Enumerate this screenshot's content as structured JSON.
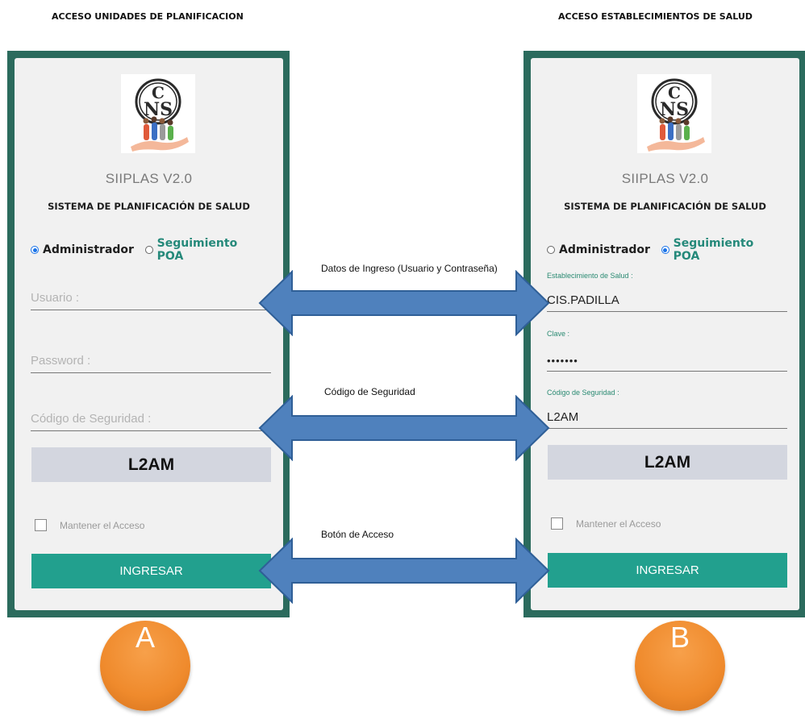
{
  "headings": {
    "left": "ACCESO UNIDADES DE PLANIFICACION",
    "right": "ACCESO ESTABLECIMIENTOS DE SALUD"
  },
  "logo": {
    "letters_top": "C",
    "letters_bottom": "NS"
  },
  "panel_a": {
    "app_title": "SIIPLAS V2.0",
    "app_subtitle": "SISTEMA DE PLANIFICACIÓN DE SALUD",
    "radio_admin": "Administrador",
    "radio_poa": "Seguimiento POA",
    "selected": "Administrador",
    "user_placeholder": "Usuario :",
    "password_placeholder": "Password :",
    "code_placeholder": "Código de Seguridad :",
    "captcha": "L2AM",
    "remember": "Mantener el Acceso",
    "submit": "INGRESAR"
  },
  "panel_b": {
    "app_title": "SIIPLAS V2.0",
    "app_subtitle": "SISTEMA DE PLANIFICACIÓN DE SALUD",
    "radio_admin": "Administrador",
    "radio_poa": "Seguimiento POA",
    "selected": "Seguimiento POA",
    "establishment_label": "Establecimiento de Salud :",
    "establishment_value": "CIS.PADILLA",
    "key_label": "Clave :",
    "key_value": "•••••••",
    "code_label": "Código de Seguridad :",
    "code_value": "L2AM",
    "captcha": "L2AM",
    "remember": "Mantener el Acceso",
    "submit": "INGRESAR"
  },
  "arrows": {
    "credentials": "Datos de Ingreso (Usuario y Contraseña)",
    "code": "Código de Seguridad",
    "button": "Botón de Acceso"
  },
  "badges": {
    "a": "A",
    "b": "B"
  },
  "colors": {
    "panel_border": "#2b6b5d",
    "accent_teal": "#22a08e",
    "arrow_fill": "#4f81bd",
    "arrow_stroke": "#2f5f97",
    "badge_orange": "#ef8a2c"
  }
}
